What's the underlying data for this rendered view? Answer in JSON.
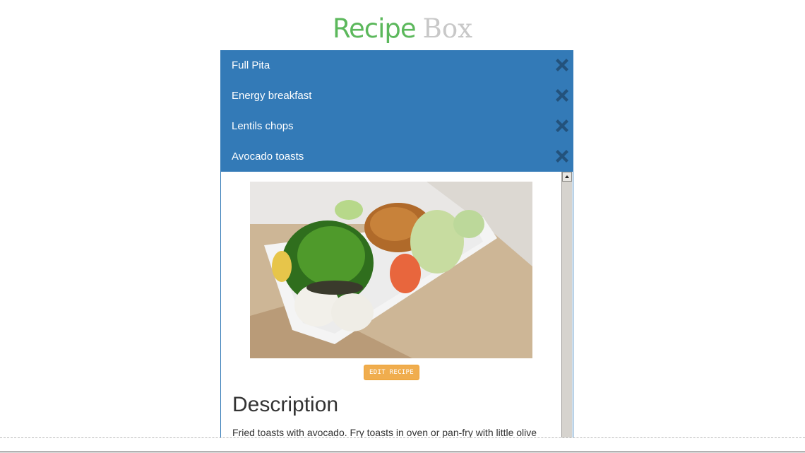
{
  "app": {
    "title_primary": "Recipe",
    "title_secondary": "Box"
  },
  "recipes": [
    {
      "name": "Full Pita"
    },
    {
      "name": "Energy breakfast"
    },
    {
      "name": "Lentils chops"
    },
    {
      "name": "Avocado toasts"
    }
  ],
  "selected_recipe": {
    "edit_label": "EDIT RECIPE",
    "description_heading": "Description",
    "description_text": "Fried toasts with avocado. Fry toasts in oven or pan-fry with little olive"
  },
  "colors": {
    "accent_green": "#5cb85c",
    "list_blue": "#337ab7",
    "edit_orange": "#f0ad4e",
    "delete_icon": "#23527c"
  },
  "icons": {
    "delete": "close-x-icon"
  }
}
